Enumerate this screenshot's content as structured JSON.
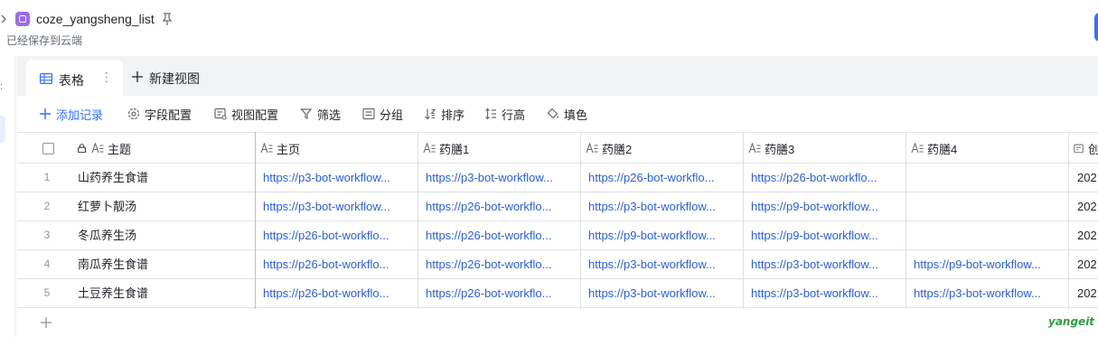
{
  "header": {
    "doc_title": "coze_yangsheng_list",
    "saved_status": "已经保存到云端"
  },
  "tabs": {
    "active_label": "表格",
    "more_label": "⋮",
    "new_view_label": "新建视图"
  },
  "toolbar": {
    "add_record": "添加记录",
    "field_config": "字段配置",
    "view_config": "视图配置",
    "filter": "筛选",
    "group": "分组",
    "sort": "排序",
    "row_height": "行高",
    "fill_color": "填色"
  },
  "table": {
    "columns": [
      "主题",
      "主页",
      "药膳1",
      "药膳2",
      "药膳3",
      "药膳4",
      "创"
    ],
    "rows": [
      {
        "num": "1",
        "title": "山药养生食谱",
        "home": "https://p3-bot-workflow...",
        "m1": "https://p3-bot-workflow...",
        "m2": "https://p26-bot-workflo...",
        "m3": "https://p26-bot-workflo...",
        "m4": "",
        "date": "202"
      },
      {
        "num": "2",
        "title": "红萝卜靓汤",
        "home": "https://p3-bot-workflow...",
        "m1": "https://p26-bot-workflo...",
        "m2": "https://p3-bot-workflow...",
        "m3": "https://p9-bot-workflow...",
        "m4": "",
        "date": "202"
      },
      {
        "num": "3",
        "title": "冬瓜养生汤",
        "home": "https://p26-bot-workflo...",
        "m1": "https://p26-bot-workflo...",
        "m2": "https://p9-bot-workflow...",
        "m3": "https://p9-bot-workflow...",
        "m4": "",
        "date": "202"
      },
      {
        "num": "4",
        "title": "南瓜养生食谱",
        "home": "https://p26-bot-workflo...",
        "m1": "https://p26-bot-workflo...",
        "m2": "https://p3-bot-workflow...",
        "m3": "https://p3-bot-workflow...",
        "m4": "https://p9-bot-workflow...",
        "date": "202"
      },
      {
        "num": "5",
        "title": "土豆养生食谱",
        "home": "https://p26-bot-workflo...",
        "m1": "https://p26-bot-workflo...",
        "m2": "https://p3-bot-workflow...",
        "m3": "https://p3-bot-workflow...",
        "m4": "https://p3-bot-workflow...",
        "date": "202"
      }
    ]
  },
  "watermark": "yangeit",
  "colors": {
    "accent": "#3370ff",
    "link": "#2b5fd9",
    "app_icon": "#9b6cf0"
  }
}
